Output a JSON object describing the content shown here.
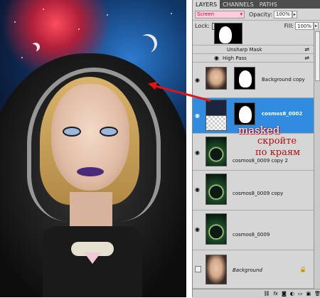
{
  "panel_tabs": [
    "LAYERS",
    "CHANNELS",
    "PATHS"
  ],
  "blend_mode": "Screen",
  "opacity": {
    "label": "Opacity:",
    "value": "100%"
  },
  "lock": {
    "label": "Lock:"
  },
  "fill": {
    "label": "Fill:",
    "value": "100%"
  },
  "layers": [
    {
      "name": "Unsharp Mask"
    },
    {
      "name": "High Pass"
    },
    {
      "name": "Background copy"
    },
    {
      "name": "cosmos8_0002"
    },
    {
      "name": "cosmos8_0009 copy 2"
    },
    {
      "name": "cosmos8_0009 copy"
    },
    {
      "name": "cosmos8_0009"
    },
    {
      "name": "Background"
    }
  ],
  "annotations": {
    "masked": "masked",
    "russian_line1": "скройте",
    "russian_line2": "по краям"
  },
  "bottom_icons": [
    "link-icon",
    "fx-icon",
    "mask-icon",
    "adjustment-icon",
    "group-icon",
    "new-layer-icon",
    "trash-icon"
  ]
}
